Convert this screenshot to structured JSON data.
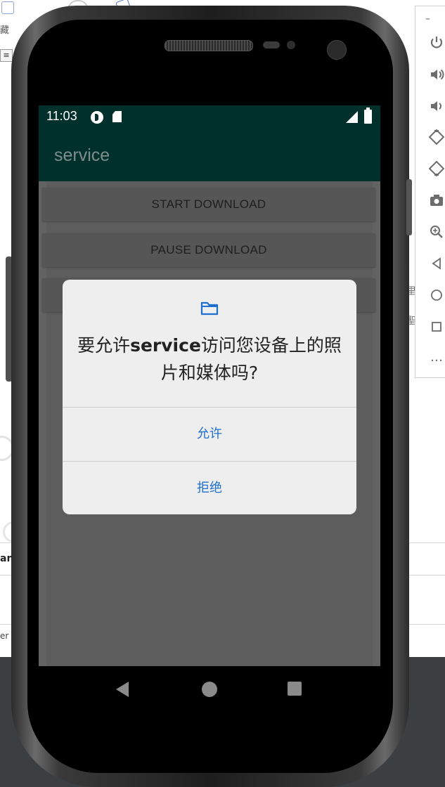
{
  "host": {
    "favorites_fragment": "藏",
    "menu_glyph": "≡",
    "bottom_fragment": "an",
    "footer_fragment": "er",
    "side_chars": [
      "里",
      "聖"
    ]
  },
  "emulator_toolbar": {
    "minimize_glyph": "–",
    "icons": [
      "power-icon",
      "volume-up-icon",
      "volume-down-icon",
      "rotate-left-icon",
      "rotate-right-icon",
      "camera-icon",
      "zoom-icon",
      "back-icon",
      "home-icon",
      "overview-icon",
      "more-icon"
    ],
    "more_glyph": "…"
  },
  "status_bar": {
    "time": "11:03"
  },
  "app": {
    "title": "service",
    "buttons": {
      "start": "START DOWNLOAD",
      "pause": "PAUSE DOWNLOAD"
    }
  },
  "dialog": {
    "icon": "folder-icon",
    "message_prefix": "要允许",
    "message_app": "service",
    "message_suffix": "访问您设备上的照片和媒体吗?",
    "allow": "允许",
    "deny": "拒绝"
  },
  "colors": {
    "app_bar": "#00302c",
    "dialog_action": "#1e6fd0",
    "scrim_content": "#626262"
  }
}
